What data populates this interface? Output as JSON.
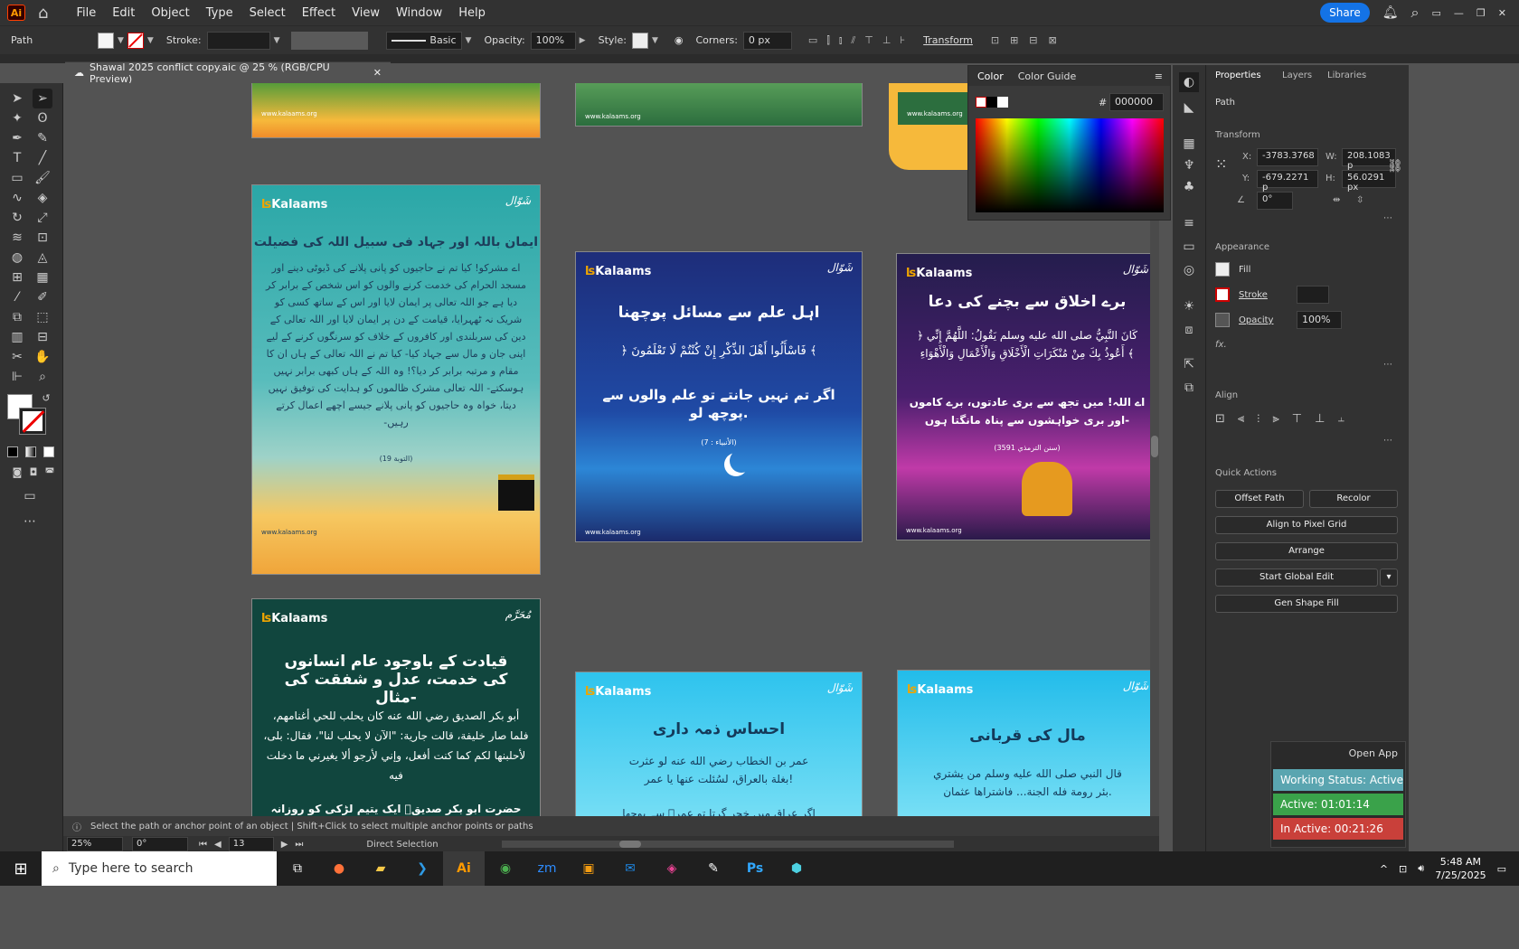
{
  "menubar": {
    "app": "Ai",
    "items": [
      "File",
      "Edit",
      "Object",
      "Type",
      "Select",
      "Effect",
      "View",
      "Window",
      "Help"
    ],
    "share": "Share"
  },
  "control": {
    "path": "Path",
    "stroke": "Stroke:",
    "brush": "Basic",
    "opacity_label": "Opacity:",
    "opacity": "100%",
    "style_label": "Style:",
    "corners_label": "Corners:",
    "corners": "0 px",
    "transform": "Transform"
  },
  "doc": {
    "tab": "Shawal 2025 conflict copy.aic @ 25 % (RGB/CPU Preview)"
  },
  "color": {
    "tab1": "Color",
    "tab2": "Color Guide",
    "hex": "000000"
  },
  "props": {
    "tabs": [
      "Properties",
      "Layers",
      "Libraries"
    ],
    "path": "Path",
    "transform": "Transform",
    "x_label": "X:",
    "x": "-3783.3768",
    "w_label": "W:",
    "w": "208.1083 p",
    "y_label": "Y:",
    "y": "-679.2271 p",
    "h_label": "H:",
    "h": "56.0291 px",
    "angle": "0°",
    "appearance": "Appearance",
    "fill": "Fill",
    "stroke": "Stroke",
    "opacity_label": "Opacity",
    "opacity": "100%",
    "fx": "fx.",
    "align": "Align",
    "quick": "Quick Actions",
    "offset": "Offset Path",
    "recolor": "Recolor",
    "align_pixel": "Align to Pixel Grid",
    "arrange": "Arrange",
    "global": "Start Global Edit",
    "genfill": "Gen Shape Fill"
  },
  "timers": {
    "open": "Open App",
    "status": "Working Status: Active",
    "active": "Active: 01:01:14",
    "inactive": "In Active: 00:21:26"
  },
  "status": {
    "hint": "Select the path or anchor point of an object  |  Shift+Click to select multiple anchor points or paths",
    "zoom": "25%",
    "rotate": "0°",
    "page": "13",
    "tool": "Direct Selection"
  },
  "taskbar": {
    "search": "Type here to search",
    "time": "5:48 AM",
    "date": "7/25/2025"
  },
  "art": {
    "brand": "Kalaams",
    "site": "www.kalaams.org",
    "badge_shawal": "شَوّال",
    "badge_muharram": "مُحَرَّم",
    "a1_title": "ایمان باللہ اور جہاد فی سبیل اللہ کی فضیلت",
    "a1_body": "اے مشرکو! کیا تم نے حاجیوں کو پانی پلانے کی ڈیوٹی دینے اور مسجد الحرام کی خدمت کرنے والوں کو اس شخص کے برابر کر دیا ہے جو اللہ تعالی پر ایمان لایا اور اس کے ساتھ کسی کو شریک نہ ٹھہرایا، قیامت کے دن پر ایمان لایا اور اللہ تعالی کے دین کی سربلندی اور کافروں کے خلاف کو سرنگوں کرنے کے لیے اپنی جان و مال سے جہاد کیا- کیا تم نے اللہ تعالی کے ہاں ان کا مقام و مرتبہ برابر کر دیا؟! وہ اللہ کے ہاں کبھی برابر نہیں ہوسکتے- اللہ تعالی مشرک ظالموں کو ہدایت کی توفیق نہیں دیتا، خواہ وہ حاجیوں کو پانی پلانے جیسے اچھے اعمال کرتے رہیں-",
    "a1_ref": "(التوبة 19)",
    "a2_title": "اہل علم سے مسائل پوچھنا",
    "a2_arabic": "﴿ فَاسْأَلُوا أَهْلَ الذِّكْرِ إِنْ كُنْتُمْ لَا تَعْلَمُونَ ﴾",
    "a2_body": "اگر تم نہیں جانتے تو علم والوں سے پوچھ لو.",
    "a2_ref": "(الأنبياء : 7)",
    "a3_title": "برے اخلاق سے بچنے کی دعا",
    "a3_arabic": "﴿ كَانَ النَّبِيُّ صلى الله عليه وسلم يَقُولُ: اللَّهُمَّ إِنِّي أَعُوذُ بِكَ مِنْ مُنْكَرَاتِ الْأَخْلَاقِ وَالْأَعْمَالِ وَالْأَهْوَاءِ ﴾",
    "a3_body": "اے اللہ! میں تجھ سے بری عادتوں، برے کاموں اور بری خواہشوں سے پناہ مانگتا ہوں-",
    "a3_ref": "(سنن الترمذي 3591)",
    "a4_title": "قیادت کے باوجود عام انسانوں کی خدمت، عدل و شفقت کی مثال-",
    "a4_arabic": "أبو بكر الصديق رضي الله عنه كان يحلب للحي أغنامهم، فلما صار خليفة، قالت جارية: \"الآن لا يحلب لنا\"، فقال: بلى، لأحلبنها لكم كما كنت أفعل، وإني لأرجو ألا يغيرني ما دخلت فيه",
    "a4_body": "حضرت ابو بکر صدیقؓ ایک یتیم لڑکی کو روزانہ",
    "a5_title": "احساس ذمہ داری",
    "a5_arabic": "عمر بن الخطاب رضي الله عنه لو عثرت بغلة بالعراق، لسُئلت عنها يا عمر!",
    "a5_body": "اگر عراق میں خچر گرتا تو عمرؓ سے پوچھا",
    "a6_title": "مال کی قربانی",
    "a6_arabic": "قال النبي صلى الله عليه وسلم من يشتري بئر رومة فله الجنة... فاشتراها عثمان."
  }
}
